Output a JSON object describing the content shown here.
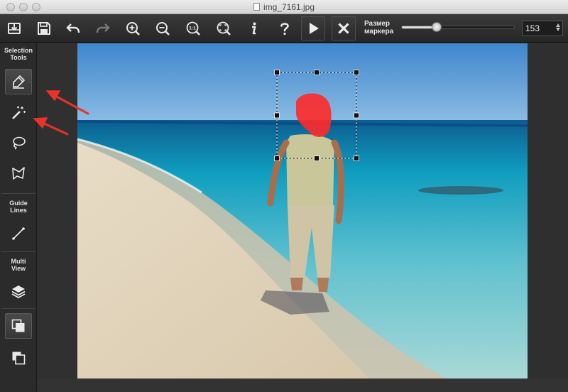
{
  "window": {
    "title": "img_7161.jpg"
  },
  "toolbar": {
    "buttons": [
      {
        "name": "open-button",
        "icon": "download-tray-icon"
      },
      {
        "name": "save-button",
        "icon": "floppy-disk-icon"
      },
      {
        "name": "undo-button",
        "icon": "undo-arrow-icon"
      },
      {
        "name": "redo-button",
        "icon": "redo-arrow-icon"
      },
      {
        "name": "zoom-in-button",
        "icon": "zoom-in-icon"
      },
      {
        "name": "zoom-out-button",
        "icon": "zoom-out-icon"
      },
      {
        "name": "actual-size-button",
        "icon": "zoom-1to1-icon"
      },
      {
        "name": "fit-screen-button",
        "icon": "zoom-fit-icon"
      },
      {
        "name": "info-button",
        "icon": "info-icon"
      },
      {
        "name": "help-button",
        "icon": "question-mark-icon"
      },
      {
        "name": "run-button",
        "icon": "play-icon"
      },
      {
        "name": "cancel-button",
        "icon": "close-x-icon"
      }
    ],
    "zoom_1to1_label": "1:1",
    "marker_label_line1": "Размер",
    "marker_label_line2": "маркера",
    "marker_size_value": "153",
    "marker_slider_fraction": 0.31
  },
  "sidebar": {
    "selection_tools_line1": "Selection",
    "selection_tools_line2": "Tools",
    "guide_lines_line1": "Guide",
    "guide_lines_line2": "Lines",
    "multi_view_line1": "Multi",
    "multi_view_line2": "View",
    "tools": [
      {
        "name": "marker-tool",
        "icon": "marker-pen-icon",
        "active": true
      },
      {
        "name": "magic-wand-tool",
        "icon": "magic-wand-icon",
        "active": false
      },
      {
        "name": "lasso-tool",
        "icon": "lasso-icon",
        "active": false
      },
      {
        "name": "polygon-lasso-tool",
        "icon": "polygon-lasso-icon",
        "active": false
      },
      {
        "name": "guide-line-tool",
        "icon": "line-icon",
        "active": false
      },
      {
        "name": "layers-view",
        "icon": "layers-icon",
        "active": false
      },
      {
        "name": "overlap-view",
        "icon": "overlap-squares-filled-icon",
        "active": true
      },
      {
        "name": "overlap-outline-view",
        "icon": "overlap-squares-outline-icon",
        "active": false
      }
    ]
  },
  "colors": {
    "selection_mark": "#ff2a2a",
    "annotation_arrow": "#e8332a",
    "sky": "#4a8fd1",
    "sea": "#12a7c3",
    "sand": "#e2d6c0"
  }
}
